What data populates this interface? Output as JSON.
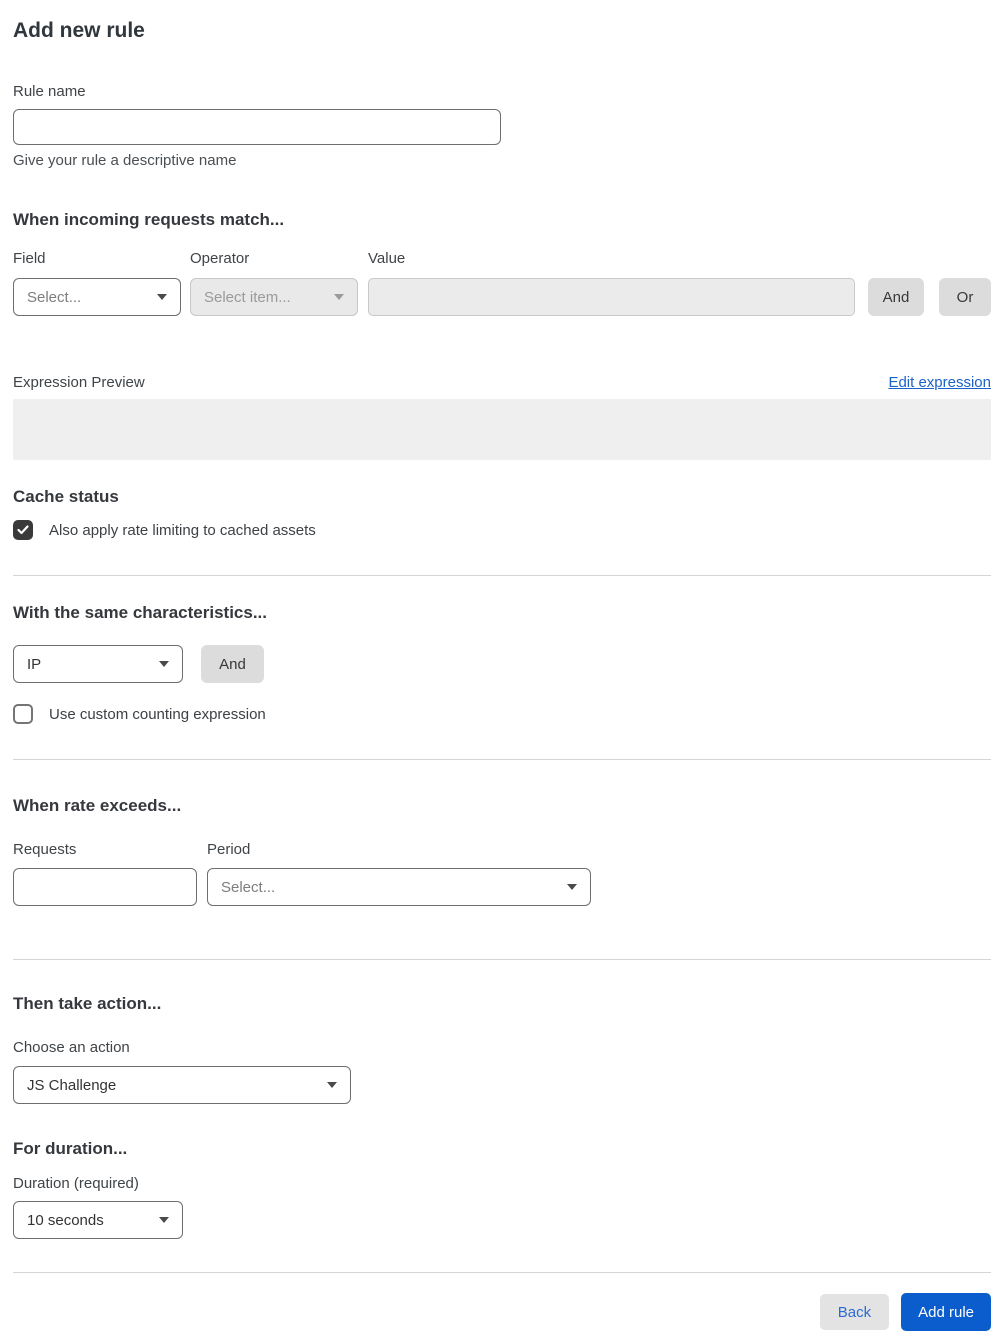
{
  "page": {
    "title": "Add new rule"
  },
  "rule_name": {
    "label": "Rule name",
    "value": "",
    "help": "Give your rule a descriptive name"
  },
  "match": {
    "heading": "When incoming requests match...",
    "field_label": "Field",
    "field_value": "Select...",
    "operator_label": "Operator",
    "operator_value": "Select item...",
    "value_label": "Value",
    "value_text": "",
    "and_label": "And",
    "or_label": "Or"
  },
  "expression": {
    "label": "Expression Preview",
    "edit_link": "Edit expression",
    "preview": ""
  },
  "cache": {
    "heading": "Cache status",
    "checkbox_label": "Also apply rate limiting to cached assets",
    "checked": true
  },
  "characteristics": {
    "heading": "With the same characteristics...",
    "select_value": "IP",
    "and_label": "And",
    "checkbox_label": "Use custom counting expression",
    "checked": false
  },
  "rate": {
    "heading": "When rate exceeds...",
    "requests_label": "Requests",
    "requests_value": "",
    "period_label": "Period",
    "period_value": "Select..."
  },
  "action": {
    "heading": "Then take action...",
    "label": "Choose an action",
    "value": "JS Challenge"
  },
  "duration": {
    "heading": "For duration...",
    "label": "Duration (required)",
    "value": "10 seconds"
  },
  "footer": {
    "back_label": "Back",
    "submit_label": "Add rule"
  },
  "colors": {
    "primary_blue": "#0b5dce",
    "link_blue": "#1b62c9"
  }
}
